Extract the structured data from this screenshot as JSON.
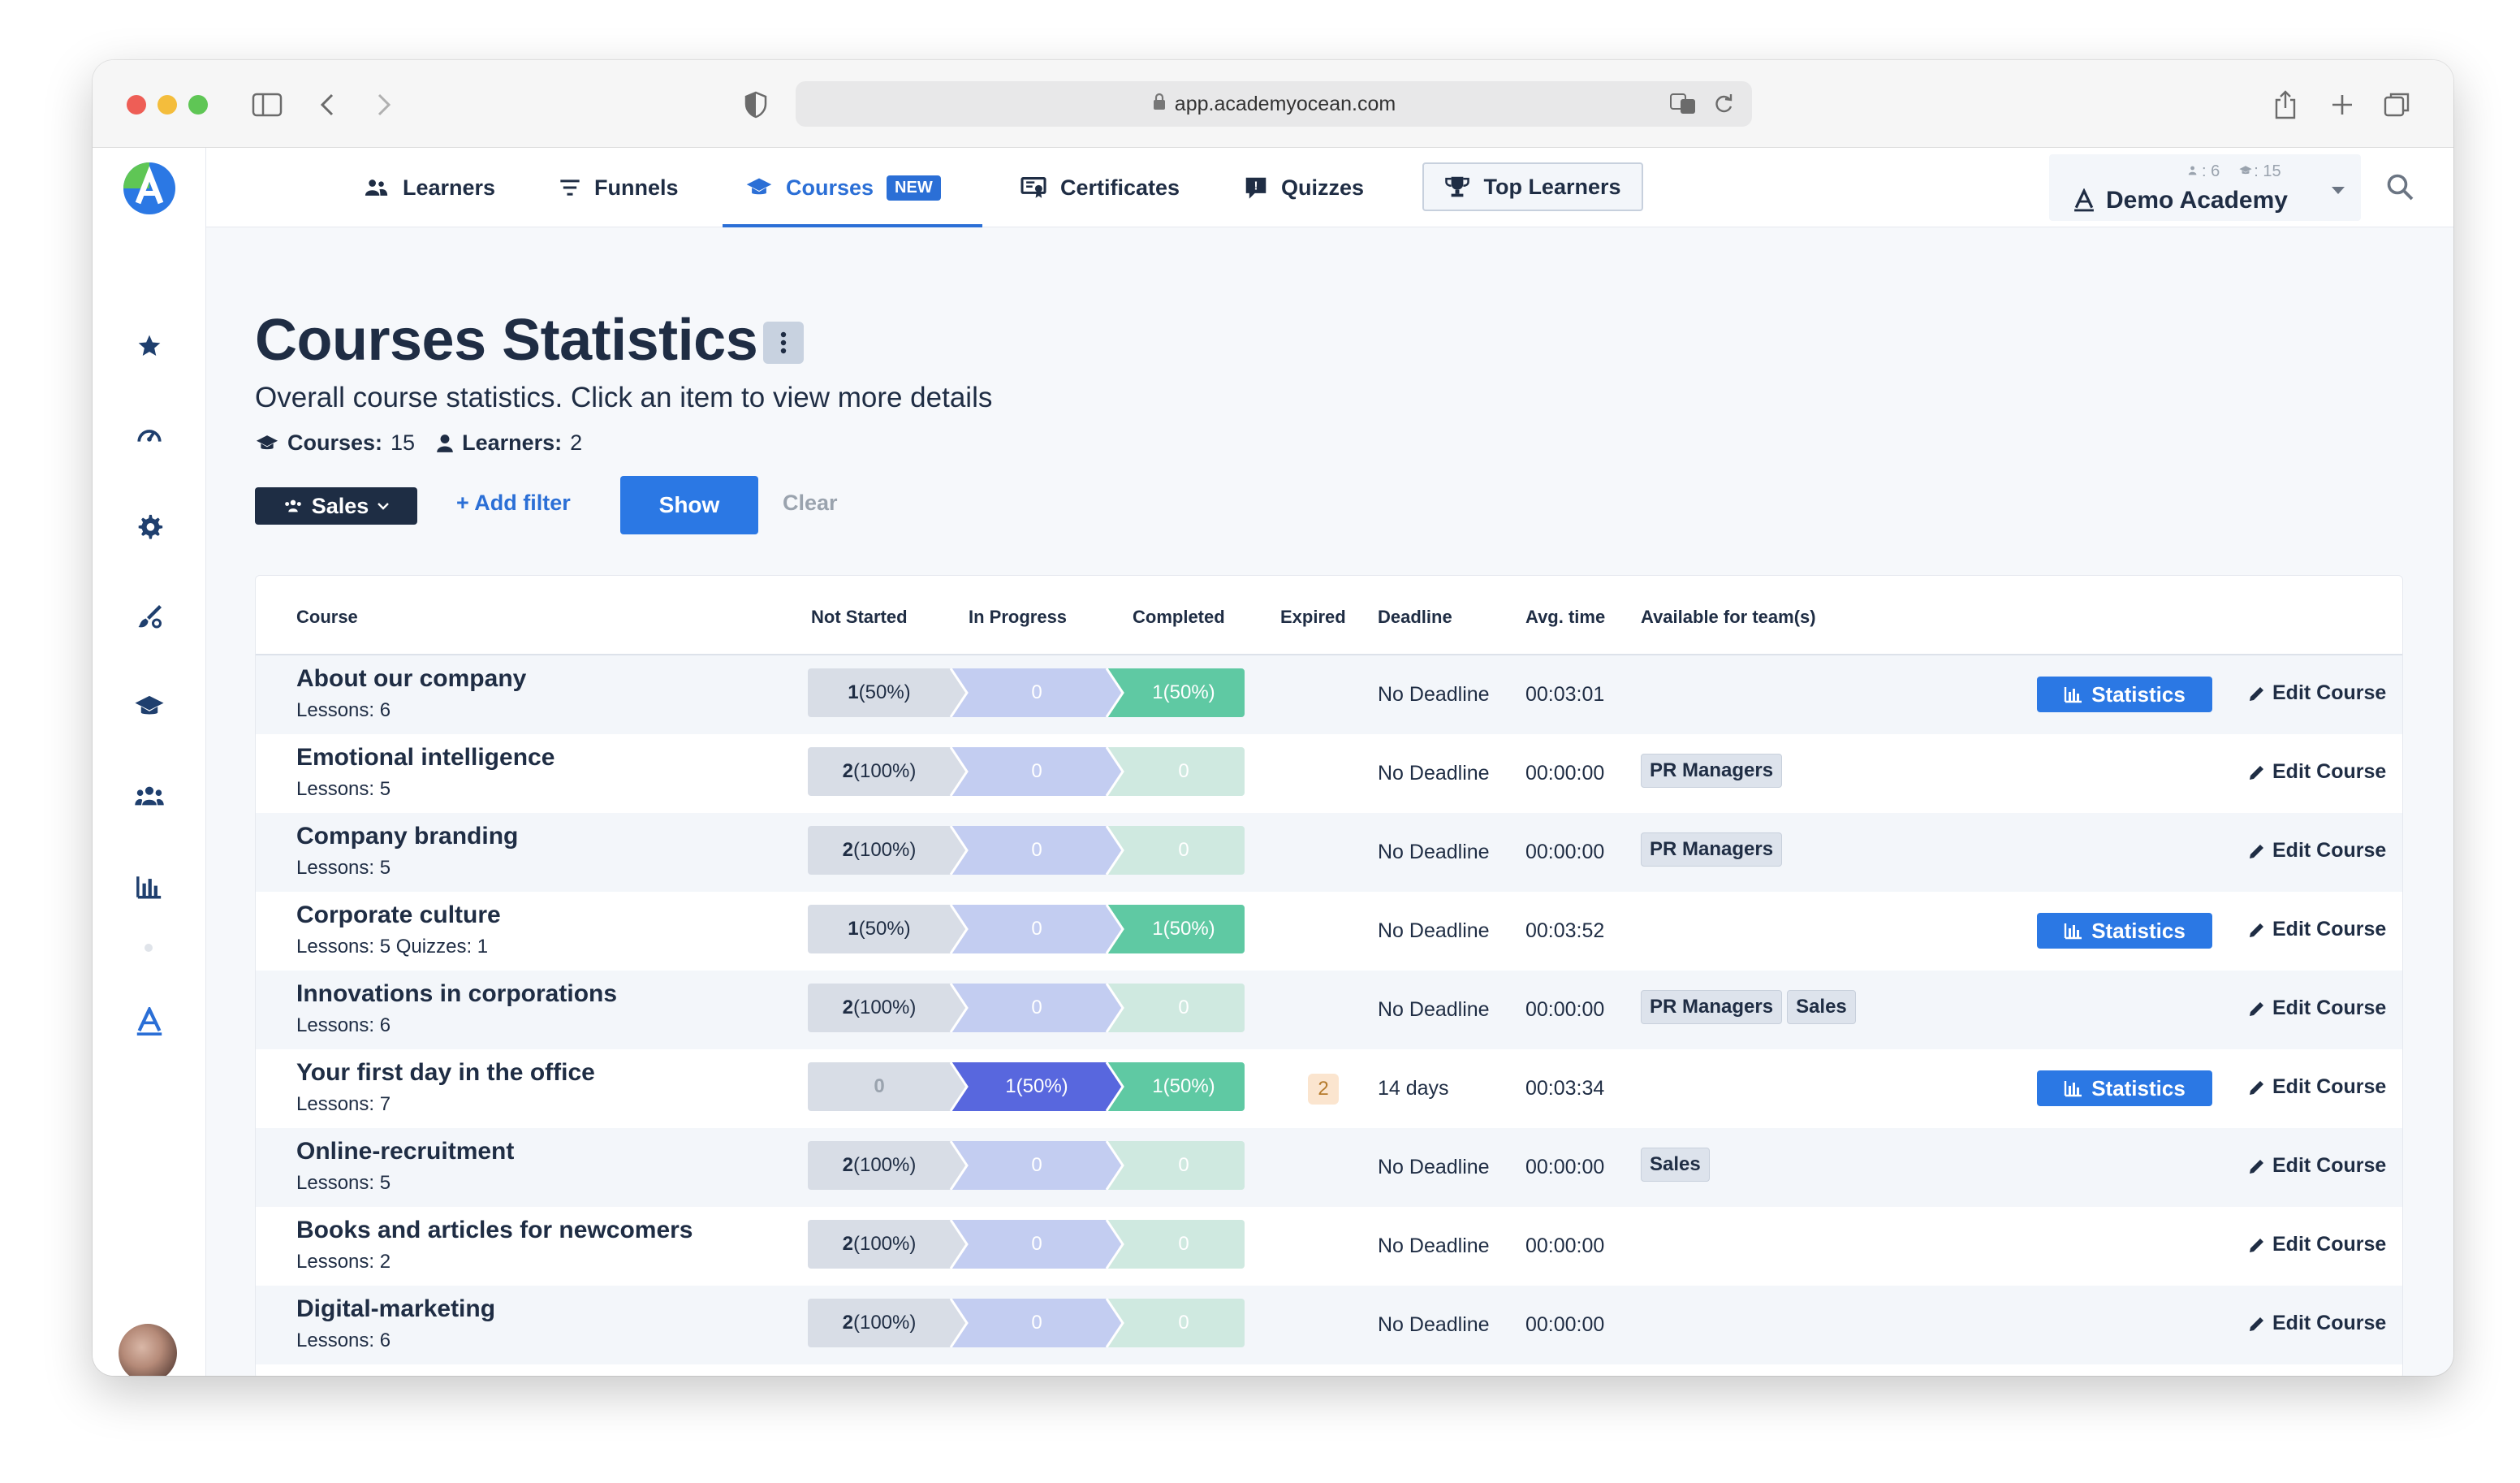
{
  "browser": {
    "url": "app.academyocean.com"
  },
  "nav": {
    "items": [
      {
        "label": "Learners",
        "icon": "users-icon"
      },
      {
        "label": "Funnels",
        "icon": "filter-icon"
      },
      {
        "label": "Courses",
        "icon": "graduation-cap-icon",
        "active": true,
        "badge": "NEW"
      },
      {
        "label": "Certificates",
        "icon": "certificate-icon"
      },
      {
        "label": "Quizzes",
        "icon": "quiz-icon"
      }
    ],
    "top_learners": "Top Learners",
    "academy": {
      "name": "Demo Academy",
      "learners_count": ": 6",
      "courses_count": ": 15"
    }
  },
  "page": {
    "title": "Courses Statistics",
    "subtitle": "Overall course statistics. Click an item to view more details",
    "courses_label": "Courses:",
    "courses_value": "15",
    "learners_label": "Learners:",
    "learners_value": "2"
  },
  "filters": {
    "sales": "Sales",
    "add_filter": "+ Add filter",
    "show": "Show",
    "clear": "Clear"
  },
  "table": {
    "headers": {
      "course": "Course",
      "not_started": "Not Started",
      "in_progress": "In Progress",
      "completed": "Completed",
      "expired": "Expired",
      "deadline": "Deadline",
      "avg_time": "Avg. time",
      "teams": "Available for team(s)"
    },
    "statistics_label": "Statistics",
    "edit_label": "Edit Course",
    "rows": [
      {
        "name": "About our company",
        "sub": "Lessons: 6",
        "ns_n": "1",
        "ns_p": " (50%)",
        "ip_n": "0",
        "ip_p": "",
        "co_n": "1",
        "co_p": " (50%)",
        "expired": "",
        "deadline": "No Deadline",
        "time": "00:03:01",
        "teams": [],
        "stats": true
      },
      {
        "name": "Emotional intelligence",
        "sub": "Lessons: 5",
        "ns_n": "2",
        "ns_p": " (100%)",
        "ip_n": "0",
        "ip_p": "",
        "co_n": "0",
        "co_p": "",
        "expired": "",
        "deadline": "No Deadline",
        "time": "00:00:00",
        "teams": [
          "PR Managers"
        ],
        "stats": false
      },
      {
        "name": "Company branding",
        "sub": "Lessons: 5",
        "ns_n": "2",
        "ns_p": " (100%)",
        "ip_n": "0",
        "ip_p": "",
        "co_n": "0",
        "co_p": "",
        "expired": "",
        "deadline": "No Deadline",
        "time": "00:00:00",
        "teams": [
          "PR Managers"
        ],
        "stats": false
      },
      {
        "name": "Corporate culture",
        "sub": "Lessons: 5  Quizzes: 1",
        "ns_n": "1",
        "ns_p": " (50%)",
        "ip_n": "0",
        "ip_p": "",
        "co_n": "1",
        "co_p": " (50%)",
        "expired": "",
        "deadline": "No Deadline",
        "time": "00:03:52",
        "teams": [],
        "stats": true
      },
      {
        "name": "Innovations in corporations",
        "sub": "Lessons: 6",
        "ns_n": "2",
        "ns_p": " (100%)",
        "ip_n": "0",
        "ip_p": "",
        "co_n": "0",
        "co_p": "",
        "expired": "",
        "deadline": "No Deadline",
        "time": "00:00:00",
        "teams": [
          "PR Managers",
          "Sales"
        ],
        "stats": false
      },
      {
        "name": "Your first day in the office",
        "sub": "Lessons: 7",
        "ns_n": "0",
        "ns_p": "",
        "ip_n": "1",
        "ip_p": " (50%)",
        "co_n": "1",
        "co_p": " (50%)",
        "expired": "2",
        "deadline": "14 days",
        "time": "00:03:34",
        "teams": [],
        "stats": true
      },
      {
        "name": "Online-recruitment",
        "sub": "Lessons: 5",
        "ns_n": "2",
        "ns_p": " (100%)",
        "ip_n": "0",
        "ip_p": "",
        "co_n": "0",
        "co_p": "",
        "expired": "",
        "deadline": "No Deadline",
        "time": "00:00:00",
        "teams": [
          "Sales"
        ],
        "stats": false
      },
      {
        "name": "Books and articles for newcomers",
        "sub": "Lessons: 2",
        "ns_n": "2",
        "ns_p": " (100%)",
        "ip_n": "0",
        "ip_p": "",
        "co_n": "0",
        "co_p": "",
        "expired": "",
        "deadline": "No Deadline",
        "time": "00:00:00",
        "teams": [],
        "stats": false
      },
      {
        "name": "Digital-marketing",
        "sub": "Lessons: 6",
        "ns_n": "2",
        "ns_p": " (100%)",
        "ip_n": "0",
        "ip_p": "",
        "co_n": "0",
        "co_p": "",
        "expired": "",
        "deadline": "No Deadline",
        "time": "00:00:00",
        "teams": [],
        "stats": false
      }
    ]
  },
  "colors": {
    "accent": "#2b78e4",
    "not_started": "#d8dde6",
    "in_progress_zero": "#c3cdf1",
    "in_progress_active": "#5867de",
    "completed_zero": "#cfe9e0",
    "completed_active": "#5fc9a3"
  }
}
